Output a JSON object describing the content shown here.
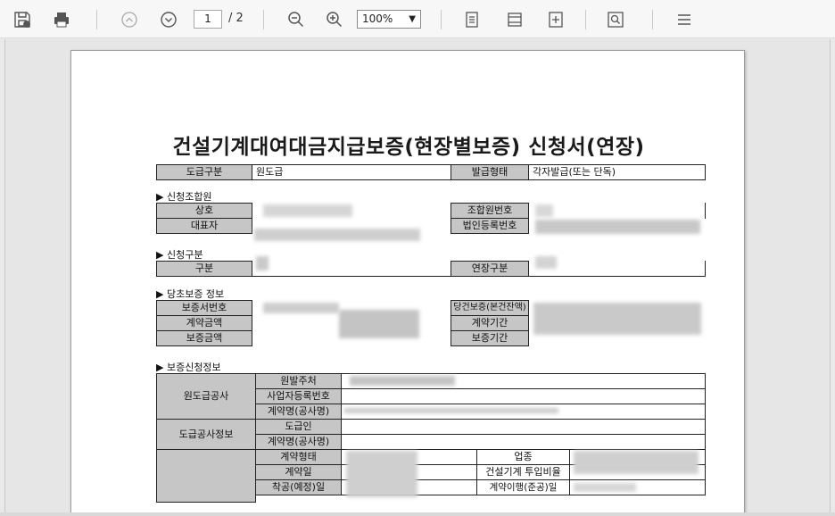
{
  "toolbar": {
    "current_page": "1",
    "total_pages": "/ 2",
    "zoom": "100%",
    "icons": [
      "save-icon",
      "print-icon",
      "prev-page-icon",
      "next-page-icon",
      "zoom-out-icon",
      "zoom-in-icon",
      "page-view-icon",
      "fit-width-icon",
      "fit-page-icon",
      "search-icon",
      "menu-icon"
    ]
  },
  "document": {
    "title": "건설기계대여대금지급보증(현장별보증) 신청서(연장)",
    "row1": {
      "l1": "도급구분",
      "v1": "원도급",
      "l2": "발급형태",
      "v2": "각자발급(또는 단독)"
    },
    "applicant": {
      "heading": "▶ 신청조합원",
      "l_name": "상호",
      "l_member_no": "조합원번호",
      "l_rep": "대표자",
      "l_corp_no": "법인등록번호"
    },
    "category": {
      "heading": "▶ 신청구분",
      "l_type": "구분",
      "l_ext": "연장구분"
    },
    "original": {
      "heading": "▶ 당초보증 정보",
      "l_cert_no": "보증서번호",
      "l_current": "당건보증(본건잔액)",
      "l_amount": "계약금액",
      "l_period": "계약기간",
      "l_guar_amount": "보증금액",
      "l_guar_period": "보증기간"
    },
    "request": {
      "heading": "▶ 보증신청정보",
      "g1": "원도급공사",
      "g1_r1": "원발주처",
      "g1_r2": "사업자등록번호",
      "g1_r3": "계약명(공사명)",
      "g2": "도급공사정보",
      "g2_r1": "도급인",
      "g2_r2": "계약명(공사명)",
      "g3_r1": "계약형태",
      "g3_r2": "계약일",
      "g3_r3": "착공(예정)일",
      "g3_r1b": "업종",
      "g3_r2b": "건설기계 투입비율",
      "g3_r3b": "계약이행(준공)일"
    }
  },
  "colors": {
    "label_bg": "#c6c6c6",
    "toolbar_bg": "#f7f7f7",
    "viewer_bg": "#e6e6e6"
  }
}
